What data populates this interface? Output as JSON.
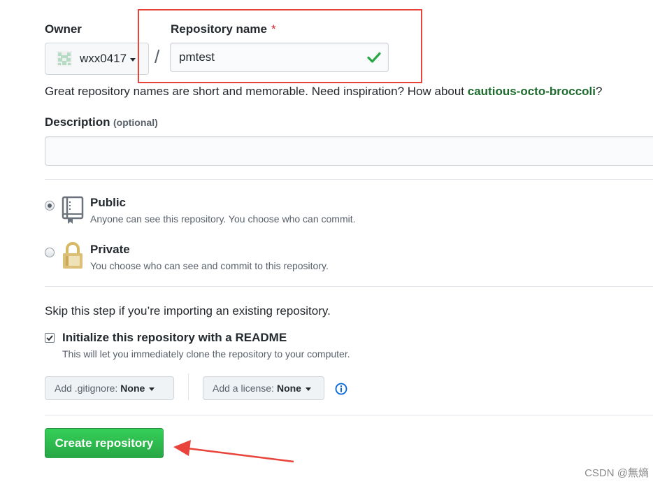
{
  "owner": {
    "label": "Owner",
    "username": "wxx0417"
  },
  "repo": {
    "label": "Repository name",
    "required_mark": "*",
    "value": "pmtest"
  },
  "hint": {
    "prefix": "Great repository names are short and memorable. Need inspiration? How about ",
    "suggestion": "cautious-octo-broccoli",
    "suffix": "?"
  },
  "description": {
    "label": "Description",
    "optional": "(optional)",
    "value": ""
  },
  "visibility": {
    "public": {
      "title": "Public",
      "desc": "Anyone can see this repository. You choose who can commit.",
      "selected": true
    },
    "private": {
      "title": "Private",
      "desc": "You choose who can see and commit to this repository.",
      "selected": false
    }
  },
  "init": {
    "skip_text": "Skip this step if you’re importing an existing repository.",
    "readme_title": "Initialize this repository with a README",
    "readme_desc": "This will let you immediately clone the repository to your computer.",
    "readme_checked": true
  },
  "gitignore": {
    "label": "Add .gitignore:",
    "value": "None"
  },
  "license": {
    "label": "Add a license:",
    "value": "None"
  },
  "create_button": "Create repository",
  "watermark": "CSDN @無熵",
  "colors": {
    "accent_green": "#2ea44f",
    "annotation_red": "#e8443b",
    "info_blue": "#0366d6"
  }
}
